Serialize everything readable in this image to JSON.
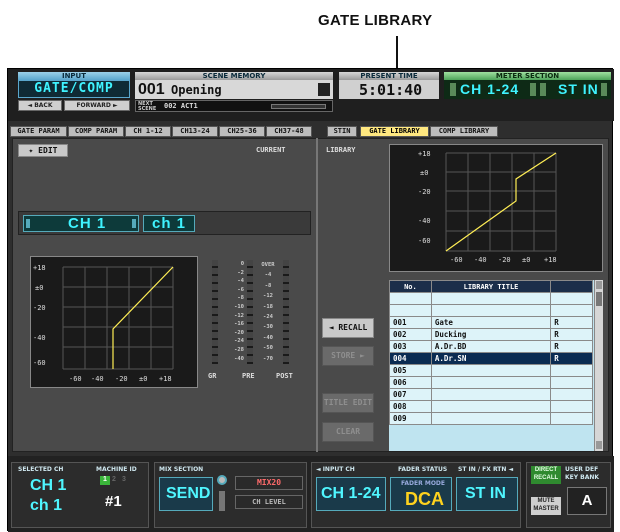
{
  "callout": {
    "label": "GATE LIBRARY"
  },
  "header": {
    "input_label": "INPUT",
    "module_title": "GATE/COMP",
    "back_label": "◄ BACK",
    "forward_label": "FORWARD ►",
    "scene_memory_label": "SCENE MEMORY",
    "scene_number": "001",
    "scene_name": "Opening",
    "next_scene_label": "NEXT SCENE",
    "next_scene": "002 ACT1",
    "present_time_label": "PRESENT TIME",
    "present_time": "5:01:40",
    "meter_section_label": "METER SECTION",
    "meter_ch": "CH 1-24",
    "meter_stin": "ST IN"
  },
  "tabs": [
    {
      "label": "GATE PARAM"
    },
    {
      "label": "COMP PARAM"
    },
    {
      "label": "CH 1-12"
    },
    {
      "label": "CH13-24"
    },
    {
      "label": "CH25-36"
    },
    {
      "label": "CH37-48"
    },
    {
      "label": "STIN"
    },
    {
      "label": "GATE LIBRARY"
    },
    {
      "label": "COMP LIBRARY"
    }
  ],
  "left": {
    "edit_label": "✦ EDIT",
    "current_label": "CURRENT",
    "channel": "CH 1",
    "channel_name": "ch 1",
    "graph_y_ticks": [
      "+18",
      "±0",
      "-20",
      "-40",
      "-60"
    ],
    "graph_x_ticks": [
      "-60",
      "-40",
      "-20",
      "±0",
      "+18"
    ],
    "gr_scale": [
      "0",
      "-2",
      "-4",
      "-6",
      "-8",
      "-10",
      "-12",
      "-16",
      "-20",
      "-24",
      "-28",
      "-40"
    ],
    "pp_scale": [
      "OVER",
      "-4",
      "-8",
      "-12",
      "-18",
      "-24",
      "-30",
      "-40",
      "-50",
      "-70"
    ],
    "meter_labels": [
      "GR",
      "PRE",
      "POST"
    ]
  },
  "right": {
    "library_label": "LIBRARY",
    "graph_y_ticks": [
      "+18",
      "±0",
      "-20",
      "-40",
      "-60"
    ],
    "graph_x_ticks": [
      "-60",
      "-40",
      "-20",
      "±0",
      "+18"
    ],
    "recall_label": "◄ RECALL",
    "store_label": "STORE ►",
    "title_edit_label": "TITLE EDIT",
    "clear_label": "CLEAR",
    "table_headers": [
      "No.",
      "LIBRARY TITLE",
      ""
    ],
    "rows": [
      {
        "no": "",
        "title": "",
        "flag": ""
      },
      {
        "no": "",
        "title": "",
        "flag": ""
      },
      {
        "no": "001",
        "title": "Gate",
        "flag": "R"
      },
      {
        "no": "002",
        "title": "Ducking",
        "flag": "R"
      },
      {
        "no": "003",
        "title": "A.Dr.BD",
        "flag": "R"
      },
      {
        "no": "004",
        "title": "A.Dr.SN",
        "flag": "R"
      },
      {
        "no": "005",
        "title": "",
        "flag": ""
      },
      {
        "no": "006",
        "title": "",
        "flag": ""
      },
      {
        "no": "007",
        "title": "",
        "flag": ""
      },
      {
        "no": "008",
        "title": "",
        "flag": ""
      },
      {
        "no": "009",
        "title": "",
        "flag": ""
      }
    ]
  },
  "footer": {
    "selected_ch_label": "SELECTED CH",
    "selected_ch": "CH 1",
    "selected_ch_name": "ch 1",
    "machine_id_label": "MACHINE ID",
    "machine_nums": [
      "1",
      "2",
      "3"
    ],
    "machine_id": "#1",
    "mix_section_label": "MIX SECTION",
    "mix_mode": "SEND",
    "mix_bus": "MIX20",
    "ch_level_label": "CH LEVEL",
    "input_ch_label": "◄ INPUT CH",
    "input_ch": "CH 1-24",
    "fader_status_label": "FADER STATUS",
    "fader_mode_label": "FADER MODE",
    "fader_mode": "DCA",
    "stin_label": "ST IN / FX RTN ◄",
    "stin": "ST IN",
    "direct_recall_label": "DIRECT RECALL",
    "mute_master_label": "MUTE MASTER",
    "user_def_label": "USER DEF KEY BANK",
    "bank": "A"
  }
}
